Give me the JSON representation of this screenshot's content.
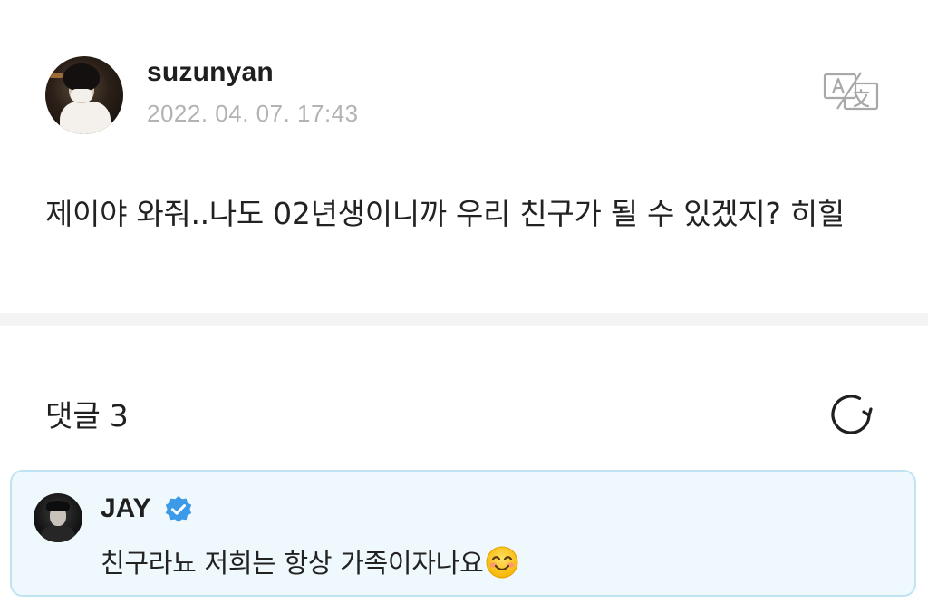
{
  "post": {
    "author": "suzunyan",
    "date": "2022. 04. 07. 17:43",
    "text": "제이야 와줘..나도 02년생이니까 우리 친구가 될 수 있겠지? 히힐",
    "translate_icon": "translate-icon"
  },
  "comments": {
    "label": "댓글",
    "count": "3",
    "refresh_icon": "refresh-icon",
    "items": [
      {
        "author": "JAY",
        "verified": true,
        "text": "친구라뇨 저희는 항상 가족이자나요",
        "emoji": "smiling-face-emoji"
      }
    ]
  },
  "colors": {
    "card_bg": "#eef8fd",
    "card_border": "#bfe3f3",
    "verified_blue": "#3b9be8",
    "date_gray": "#b3b3b3"
  }
}
